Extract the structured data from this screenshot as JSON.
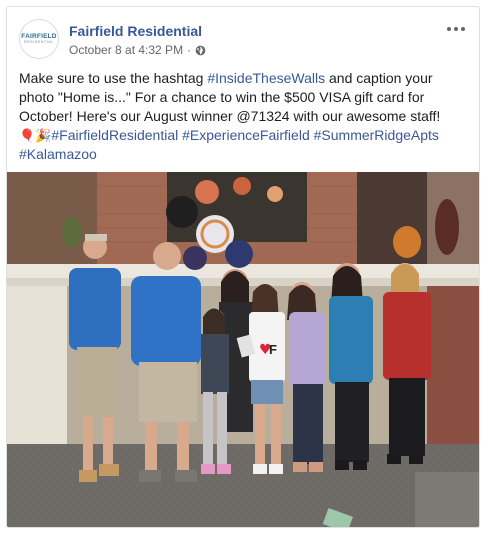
{
  "post": {
    "page_name": "Fairfield Residential",
    "timestamp": "October 8 at 4:32 PM",
    "separator": "·",
    "privacy_icon": "globe-icon",
    "more_icon": "more-options-icon",
    "avatar": {
      "logo_main": "FAIRFIELD",
      "logo_sub": "RESIDENTIAL"
    },
    "text": {
      "line1_pre": "Make sure to use the hashtag ",
      "hashtag_walls": "#InsideTheseWalls",
      "line1_post": " and caption your photo \"Home is...\" For a chance to win the $500 VISA gift card for October! Here's our August winner @71324 with our awesome staff!",
      "emojis": "🎈🎉",
      "hashtags": [
        "#FairfieldResidential",
        "#ExperienceFairfield",
        "#SummerRidgeApts",
        "#Kalamazoo"
      ]
    },
    "photo": {
      "description": "",
      "sign_text": "F"
    }
  },
  "colors": {
    "link": "#385898",
    "text": "#1c1e21",
    "meta": "#606770",
    "border": "#dddfe2"
  }
}
